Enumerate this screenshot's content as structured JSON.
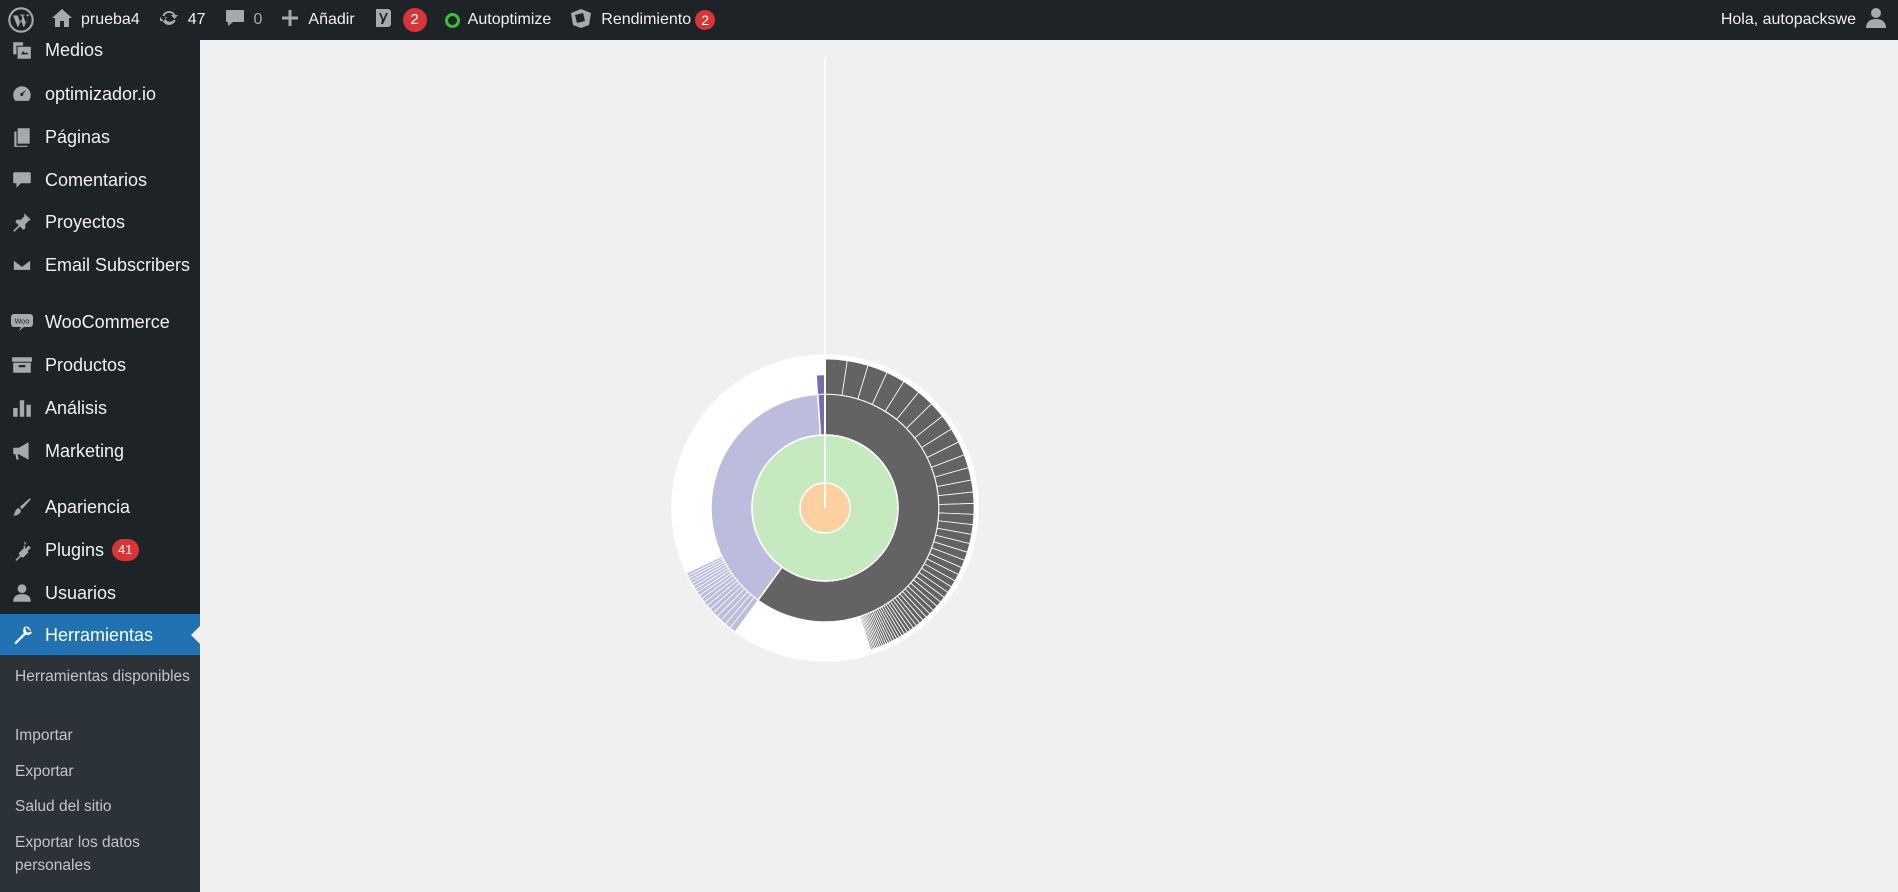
{
  "adminbar": {
    "site_name": "prueba4",
    "updates_count": "47",
    "comments_count": "0",
    "new_label": "Añadir",
    "yoast_badge": "2",
    "autoptimize_label": "Autoptimize",
    "performance_label": "Rendimiento",
    "performance_badge": "2",
    "greeting": "Hola, autopackswe"
  },
  "sidebar": {
    "items": [
      {
        "label": "Medios",
        "icon": "media-icon"
      },
      {
        "label": "optimizador.io",
        "icon": "dashboard-gauge-icon"
      },
      {
        "label": "Páginas",
        "icon": "pages-icon"
      },
      {
        "label": "Comentarios",
        "icon": "comments-icon"
      },
      {
        "label": "Proyectos",
        "icon": "pin-icon"
      },
      {
        "label": "Email Subscribers",
        "icon": "email-icon"
      },
      {
        "label": "WooCommerce",
        "icon": "woocommerce-icon"
      },
      {
        "label": "Productos",
        "icon": "archive-icon"
      },
      {
        "label": "Análisis",
        "icon": "bar-chart-icon"
      },
      {
        "label": "Marketing",
        "icon": "megaphone-icon"
      },
      {
        "label": "Apariencia",
        "icon": "paintbrush-icon"
      },
      {
        "label": "Plugins",
        "icon": "plugin-icon",
        "badge": "41"
      },
      {
        "label": "Usuarios",
        "icon": "users-icon"
      },
      {
        "label": "Herramientas",
        "icon": "wrench-icon",
        "active": true
      }
    ],
    "submenu": [
      {
        "label": "Herramientas disponibles"
      },
      {
        "label": "Importar"
      },
      {
        "label": "Exportar"
      },
      {
        "label": "Salud del sitio"
      },
      {
        "label": "Exportar los datos personales"
      }
    ]
  },
  "chart_data": {
    "type": "sunburst",
    "rings": [
      {
        "level": 0,
        "segments": [
          {
            "value": 100,
            "color": "#fdd0a2"
          }
        ]
      },
      {
        "level": 1,
        "segments": [
          {
            "value": 100,
            "color": "#c7e9c0"
          }
        ]
      },
      {
        "level": 2,
        "segments": [
          {
            "value": 60,
            "color": "#636363"
          },
          {
            "value": 39,
            "color": "#bcbddc"
          },
          {
            "value": 1,
            "color": "#756bb1"
          }
        ]
      },
      {
        "level": 3,
        "segments": [
          {
            "group": "dark",
            "count": 55,
            "share": 45,
            "color": "#636363"
          },
          {
            "group": "dark-tail",
            "share": 15,
            "color": "#ffffff"
          },
          {
            "group": "light-large",
            "count": 18,
            "share": 8,
            "color": "#bcbddc"
          },
          {
            "group": "light-tail",
            "share": 31,
            "color": "#ffffff"
          },
          {
            "group": "purple",
            "share": 1,
            "color": "#756bb1"
          }
        ]
      }
    ],
    "colors": {
      "background": "#f0f0f1",
      "stroke": "#ffffff"
    }
  },
  "colors": {
    "adminbar_bg": "#1d2327",
    "sidebar_bg": "#1d2327",
    "submenu_bg": "#2c3338",
    "active_bg": "#2271b1",
    "badge": "#d63638"
  }
}
